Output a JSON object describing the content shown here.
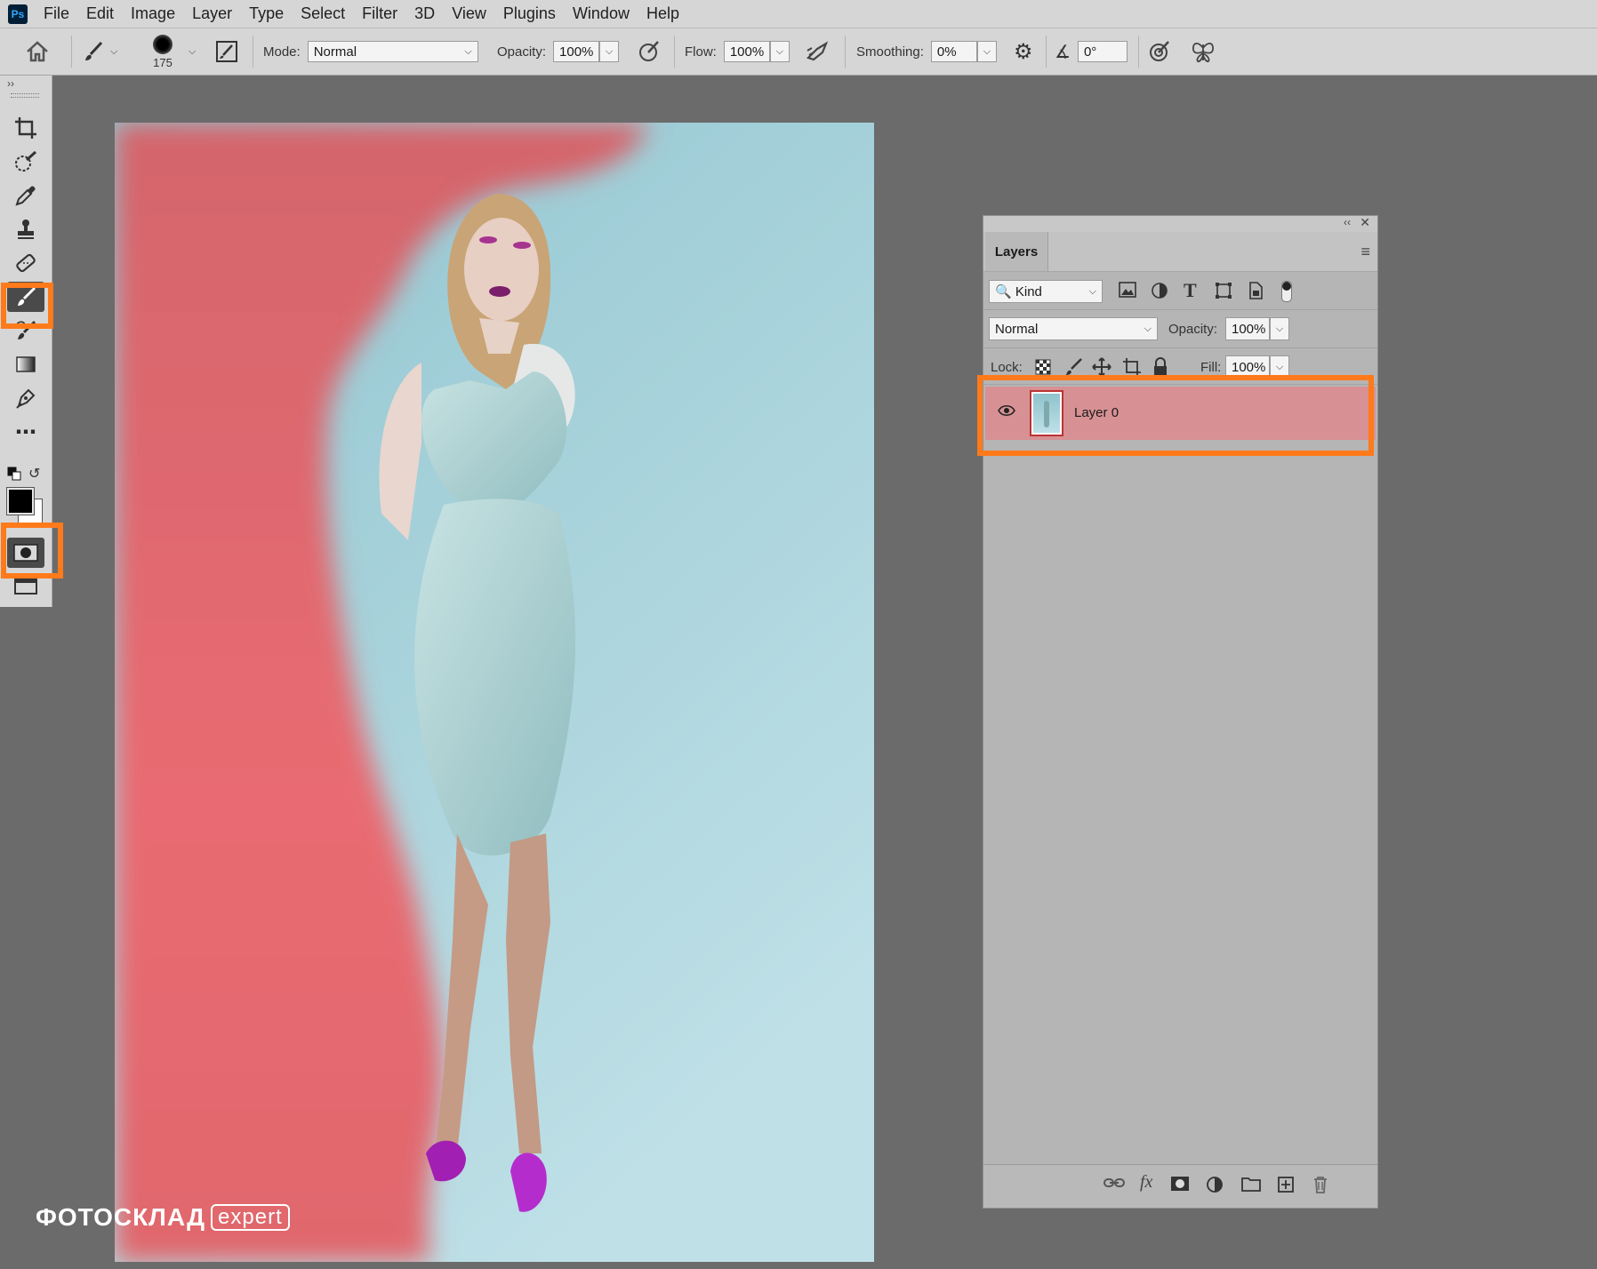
{
  "menubar": {
    "app_icon": "Ps",
    "items": [
      "File",
      "Edit",
      "Image",
      "Layer",
      "Type",
      "Select",
      "Filter",
      "3D",
      "View",
      "Plugins",
      "Window",
      "Help"
    ]
  },
  "options": {
    "brush_size": "175",
    "mode_label": "Mode:",
    "mode_value": "Normal",
    "opacity_label": "Opacity:",
    "opacity_value": "100%",
    "flow_label": "Flow:",
    "flow_value": "100%",
    "smoothing_label": "Smoothing:",
    "smoothing_value": "0%",
    "angle_value": "0°"
  },
  "layers_panel": {
    "tab": "Layers",
    "filter_kind": "Kind",
    "blend_mode": "Normal",
    "opacity_label": "Opacity:",
    "opacity_value": "100%",
    "lock_label": "Lock:",
    "fill_label": "Fill:",
    "fill_value": "100%",
    "layers": [
      {
        "name": "Layer 0",
        "visible": true
      }
    ]
  },
  "watermark": {
    "brand": "ФОТОСКЛАД",
    "tag": "expert"
  },
  "colors": {
    "highlight": "#ff7a1a",
    "quick_mask": "#e8666b",
    "background": "#a8d3dc"
  }
}
